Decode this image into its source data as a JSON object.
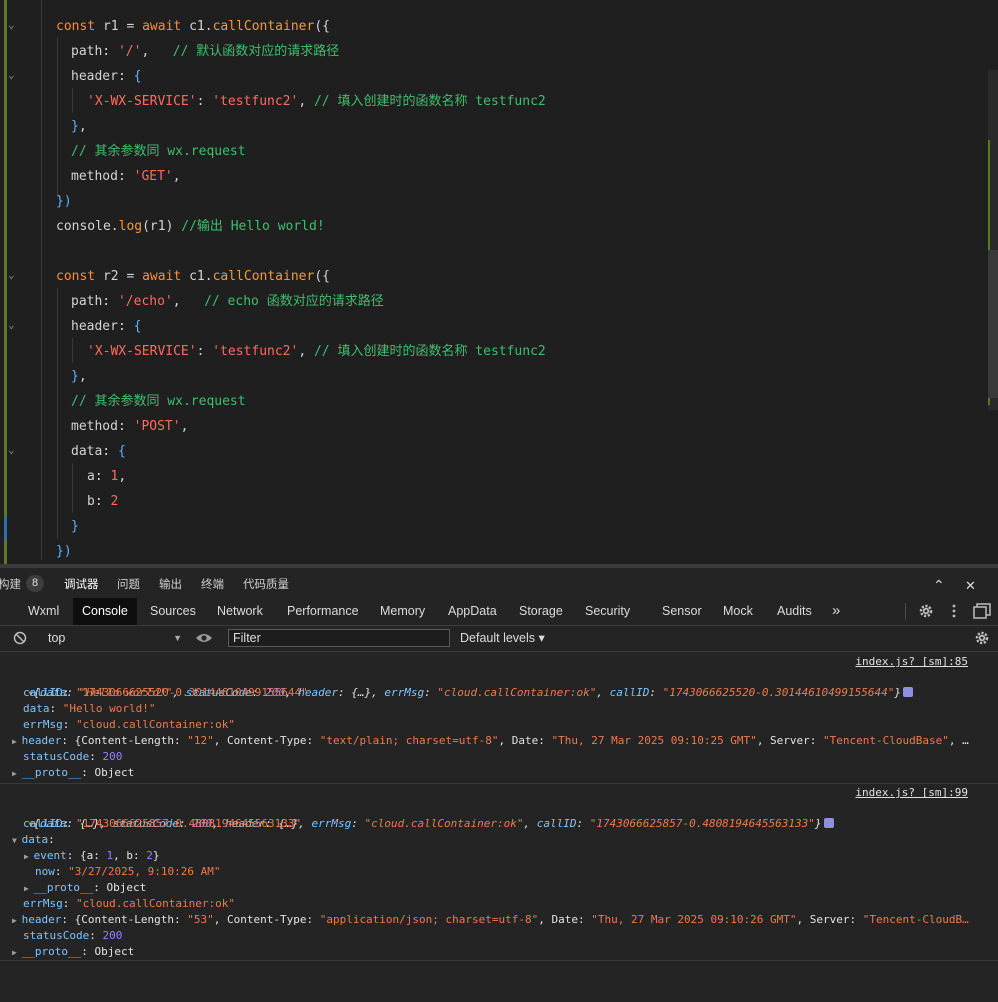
{
  "editor": {
    "lines": [
      [
        [
          "kw",
          "const "
        ],
        [
          "id",
          "r1 "
        ],
        [
          "punc",
          "= "
        ],
        [
          "kw",
          "await "
        ],
        [
          "id",
          "c1."
        ],
        [
          "fn",
          "callContainer"
        ],
        [
          "punc",
          "({"
        ]
      ],
      [
        [
          "prop",
          "path: "
        ],
        [
          "str",
          "'/'"
        ],
        [
          "punc",
          ",   "
        ],
        [
          "cm",
          "// 默认函数对应的请求路径"
        ]
      ],
      [
        [
          "prop",
          "header: "
        ],
        [
          "brace",
          "{"
        ]
      ],
      [
        [
          "str",
          "'X-WX-SERVICE'"
        ],
        [
          "punc",
          ": "
        ],
        [
          "str",
          "'testfunc2'"
        ],
        [
          "punc",
          ", "
        ],
        [
          "cm",
          "// 填入创建时的函数名称 testfunc2"
        ]
      ],
      [
        [
          "brace",
          "}"
        ],
        [
          "punc",
          ","
        ]
      ],
      [
        [
          "cm",
          "// 其余参数同 wx.request"
        ]
      ],
      [
        [
          "prop",
          "method: "
        ],
        [
          "str",
          "'GET'"
        ],
        [
          "punc",
          ","
        ]
      ],
      [
        [
          "brace",
          "})"
        ]
      ],
      [
        [
          "id",
          "console."
        ],
        [
          "fn",
          "log"
        ],
        [
          "punc",
          "(r1) "
        ],
        [
          "cm",
          "//输出 Hello world!"
        ]
      ],
      [],
      [
        [
          "kw",
          "const "
        ],
        [
          "id",
          "r2 "
        ],
        [
          "punc",
          "= "
        ],
        [
          "kw",
          "await "
        ],
        [
          "id",
          "c1."
        ],
        [
          "fn",
          "callContainer"
        ],
        [
          "punc",
          "({"
        ]
      ],
      [
        [
          "prop",
          "path: "
        ],
        [
          "str",
          "'/echo'"
        ],
        [
          "punc",
          ",   "
        ],
        [
          "cm",
          "// echo 函数对应的请求路径"
        ]
      ],
      [
        [
          "prop",
          "header: "
        ],
        [
          "brace",
          "{"
        ]
      ],
      [
        [
          "str",
          "'X-WX-SERVICE'"
        ],
        [
          "punc",
          ": "
        ],
        [
          "str",
          "'testfunc2'"
        ],
        [
          "punc",
          ", "
        ],
        [
          "cm",
          "// 填入创建时的函数名称 testfunc2"
        ]
      ],
      [
        [
          "brace",
          "}"
        ],
        [
          "punc",
          ","
        ]
      ],
      [
        [
          "cm",
          "// 其余参数同 wx.request"
        ]
      ],
      [
        [
          "prop",
          "method: "
        ],
        [
          "str",
          "'POST'"
        ],
        [
          "punc",
          ","
        ]
      ],
      [
        [
          "prop",
          "data: "
        ],
        [
          "brace",
          "{"
        ]
      ],
      [
        [
          "prop",
          "a: "
        ],
        [
          "num",
          "1"
        ],
        [
          "punc",
          ","
        ]
      ],
      [
        [
          "prop",
          "b: "
        ],
        [
          "num",
          "2"
        ]
      ],
      [
        [
          "brace",
          "}"
        ]
      ],
      [
        [
          "brace",
          "})"
        ]
      ]
    ]
  },
  "tooltabs": {
    "build": "构建",
    "badge": "8",
    "debugger": "调试器",
    "issues": "问题",
    "output": "输出",
    "terminal": "终端",
    "quality": "代码质量",
    "up": "⌃",
    "close": "✕"
  },
  "devnav": {
    "tabs": [
      "Wxml",
      "Console",
      "Sources",
      "Network",
      "Performance",
      "Memory",
      "AppData",
      "Storage",
      "Security",
      "Sensor",
      "Mock",
      "Audits"
    ],
    "more": "»"
  },
  "toolbar": {
    "context": "top",
    "filter_placeholder": "Filter",
    "levels": "Default levels ▾"
  },
  "console": {
    "entry1": {
      "source": "index.js? [sm]:85",
      "summary": [
        [
          "kd",
          "{"
        ],
        [
          "k",
          "data"
        ],
        [
          "kd",
          ": "
        ],
        [
          "s",
          "\"Hello world!\""
        ],
        [
          "kd",
          ", "
        ],
        [
          "k",
          "statusCode"
        ],
        [
          "kd",
          ": "
        ],
        [
          "n",
          "200"
        ],
        [
          "kd",
          ", "
        ],
        [
          "k",
          "header"
        ],
        [
          "kd",
          ": {…}, "
        ],
        [
          "k",
          "errMsg"
        ],
        [
          "kd",
          ": "
        ],
        [
          "s",
          "\"cloud.callContainer:ok\""
        ],
        [
          "kd",
          ", "
        ],
        [
          "k",
          "callID"
        ],
        [
          "kd",
          ": "
        ],
        [
          "s",
          "\"1743066625520-0.30144610499155644\""
        ],
        [
          "kd",
          "}"
        ]
      ],
      "rows": [
        [
          [
            "k",
            "callID"
          ],
          [
            "kd",
            ": "
          ],
          [
            "s",
            "\"1743066625520-0.30144610499155644\""
          ]
        ],
        [
          [
            "k",
            "data"
          ],
          [
            "kd",
            ": "
          ],
          [
            "s",
            "\"Hello world!\""
          ]
        ],
        [
          [
            "k",
            "errMsg"
          ],
          [
            "kd",
            ": "
          ],
          [
            "s",
            "\"cloud.callContainer:ok\""
          ]
        ],
        [
          [
            "k",
            "header"
          ],
          [
            "kd",
            ": {Content-Length: "
          ],
          [
            "s",
            "\"12\""
          ],
          [
            "kd",
            ", Content-Type: "
          ],
          [
            "s",
            "\"text/plain; charset=utf-8\""
          ],
          [
            "kd",
            ", Date: "
          ],
          [
            "s",
            "\"Thu, 27 Mar 2025 09:10:25 GMT\""
          ],
          [
            "kd",
            ", Server: "
          ],
          [
            "s",
            "\"Tencent-CloudBase\""
          ],
          [
            "kd",
            ", …"
          ]
        ],
        [
          [
            "k",
            "statusCode"
          ],
          [
            "kd",
            ": "
          ],
          [
            "n",
            "200"
          ]
        ],
        [
          [
            "k",
            "__proto__"
          ],
          [
            "kd",
            ": Object"
          ]
        ]
      ]
    },
    "entry2": {
      "source": "index.js? [sm]:99",
      "summary": [
        [
          "kd",
          "{"
        ],
        [
          "k",
          "data"
        ],
        [
          "kd",
          ": {…}, "
        ],
        [
          "k",
          "statusCode"
        ],
        [
          "kd",
          ": "
        ],
        [
          "n",
          "200"
        ],
        [
          "kd",
          ", "
        ],
        [
          "k",
          "header"
        ],
        [
          "kd",
          ": {…}, "
        ],
        [
          "k",
          "errMsg"
        ],
        [
          "kd",
          ": "
        ],
        [
          "s",
          "\"cloud.callContainer:ok\""
        ],
        [
          "kd",
          ", "
        ],
        [
          "k",
          "callID"
        ],
        [
          "kd",
          ": "
        ],
        [
          "s",
          "\"1743066625857-0.4808194645563133\""
        ],
        [
          "kd",
          "}"
        ]
      ],
      "rows": [
        [
          [
            "k",
            "callID"
          ],
          [
            "kd",
            ": "
          ],
          [
            "s",
            "\"1743066625857-0.4808194645563133\""
          ]
        ],
        [
          [
            "k",
            "data"
          ],
          [
            "kd",
            ":"
          ]
        ],
        [
          [
            "k",
            "event"
          ],
          [
            "kd",
            ": {a: "
          ],
          [
            "n",
            "1"
          ],
          [
            "kd",
            ", b: "
          ],
          [
            "n",
            "2"
          ],
          [
            "kd",
            "}"
          ]
        ],
        [
          [
            "k",
            "now"
          ],
          [
            "kd",
            ": "
          ],
          [
            "s",
            "\"3/27/2025, 9:10:26 AM\""
          ]
        ],
        [
          [
            "k",
            "__proto__"
          ],
          [
            "kd",
            ": Object"
          ]
        ],
        [
          [
            "k",
            "errMsg"
          ],
          [
            "kd",
            ": "
          ],
          [
            "s",
            "\"cloud.callContainer:ok\""
          ]
        ],
        [
          [
            "k",
            "header"
          ],
          [
            "kd",
            ": {Content-Length: "
          ],
          [
            "s",
            "\"53\""
          ],
          [
            "kd",
            ", Content-Type: "
          ],
          [
            "s",
            "\"application/json; charset=utf-8\""
          ],
          [
            "kd",
            ", Date: "
          ],
          [
            "s",
            "\"Thu, 27 Mar 2025 09:10:26 GMT\""
          ],
          [
            "kd",
            ", Server: "
          ],
          [
            "s",
            "\"Tencent-CloudB…"
          ]
        ],
        [
          [
            "k",
            "statusCode"
          ],
          [
            "kd",
            ": "
          ],
          [
            "n",
            "200"
          ]
        ],
        [
          [
            "k",
            "__proto__"
          ],
          [
            "kd",
            ": Object"
          ]
        ]
      ]
    }
  }
}
